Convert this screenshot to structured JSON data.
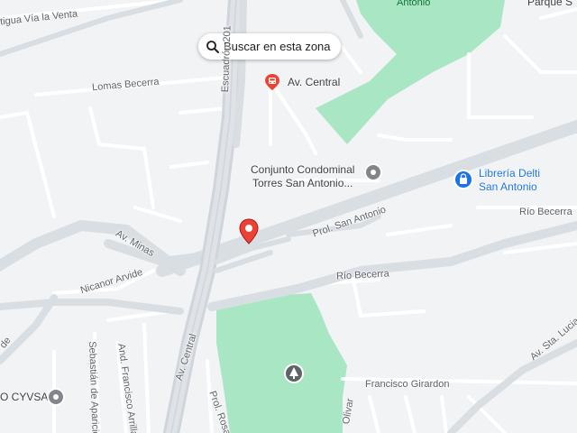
{
  "search_button": {
    "label": "Buscar en esta zona",
    "icon": "search-icon"
  },
  "colors": {
    "road": "#d9dee3",
    "minor_road": "#ffffff",
    "park": "#a8e6c4",
    "park_dark": "#8fd9b0",
    "background": "#f1f3f4",
    "pin_red": "#ea4335",
    "poi_blue": "#1a73e8",
    "poi_grey": "#80868b"
  },
  "streets": {
    "via_la_venta": "tigua Vía la Venta",
    "escuadron": "Escuadrón 201",
    "lomas_becerra": "Lomas Becerra",
    "av_minas": "Av. Minas",
    "nicanor_arvide": "Nicanor Arvide",
    "prol_san_antonio": "Prol. San Antonio",
    "rio_becerra_right": "Río Becerra",
    "rio_becerra_mid": "Río Becerra",
    "av_central": "Av. Central",
    "francisco_girardon": "Francisco Girardon",
    "olivar": "Olivar",
    "prol_rosa": "Prol. Rosa",
    "av_sta_lucia": "Av. Sta. Lucia",
    "sebastian_aparicio": "Sebastián de Aparicio",
    "and_francisco_arrilla": "And. Francisco Arrilla",
    "left_edge": "de"
  },
  "places": {
    "metro_station": {
      "label": "Av. Central",
      "icon": "train-icon"
    },
    "condominio": {
      "line1": "Conjunto Condominal",
      "line2": "Torres San Antonio...",
      "icon": "place-icon"
    },
    "libreria": {
      "line1": "Librería Delti",
      "line2": "San Antonio",
      "icon": "shopping-bag-icon"
    },
    "cyvsa": {
      "label": "O CYVSA",
      "icon": "place-icon"
    },
    "park_top": {
      "label": "Antonio"
    },
    "parque_top_right": {
      "label": "Parque S"
    }
  },
  "selected_pin": {
    "icon": "location-pin-icon"
  },
  "park_icon": {
    "icon": "tree-icon"
  }
}
